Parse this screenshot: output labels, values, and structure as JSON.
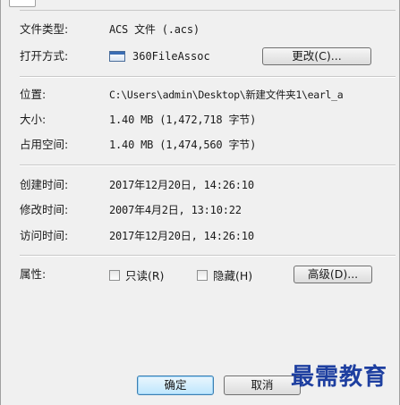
{
  "general": {
    "file_type": {
      "label": "文件类型:",
      "value": "ACS 文件 (.acs)"
    },
    "opens_with": {
      "label": "打开方式:",
      "app": "360FileAssoc",
      "change_button": "更改(C)..."
    }
  },
  "location_group": {
    "location": {
      "label": "位置:",
      "value": "C:\\Users\\admin\\Desktop\\新建文件夹1\\earl_a"
    },
    "size": {
      "label": "大小:",
      "value": "1.40 MB (1,472,718 字节)"
    },
    "size_on_disk": {
      "label": "占用空间:",
      "value": "1.40 MB (1,474,560 字节)"
    }
  },
  "times": {
    "created": {
      "label": "创建时间:",
      "value": "2017年12月20日, 14:26:10"
    },
    "modified": {
      "label": "修改时间:",
      "value": "2007年4月2日, 13:10:22"
    },
    "accessed": {
      "label": "访问时间:",
      "value": "2017年12月20日, 14:26:10"
    }
  },
  "attributes": {
    "label": "属性:",
    "readonly": {
      "label": "只读(R)",
      "checked": false
    },
    "hidden": {
      "label": "隐藏(H)",
      "checked": false
    },
    "advanced_button": "高级(D)..."
  },
  "footer": {
    "ok_button": "确定",
    "cancel_button": "取消"
  },
  "watermark": "最需教育",
  "colors": {
    "watermark": "#1e3fa0",
    "default_button_border": "#3c7fb1"
  }
}
